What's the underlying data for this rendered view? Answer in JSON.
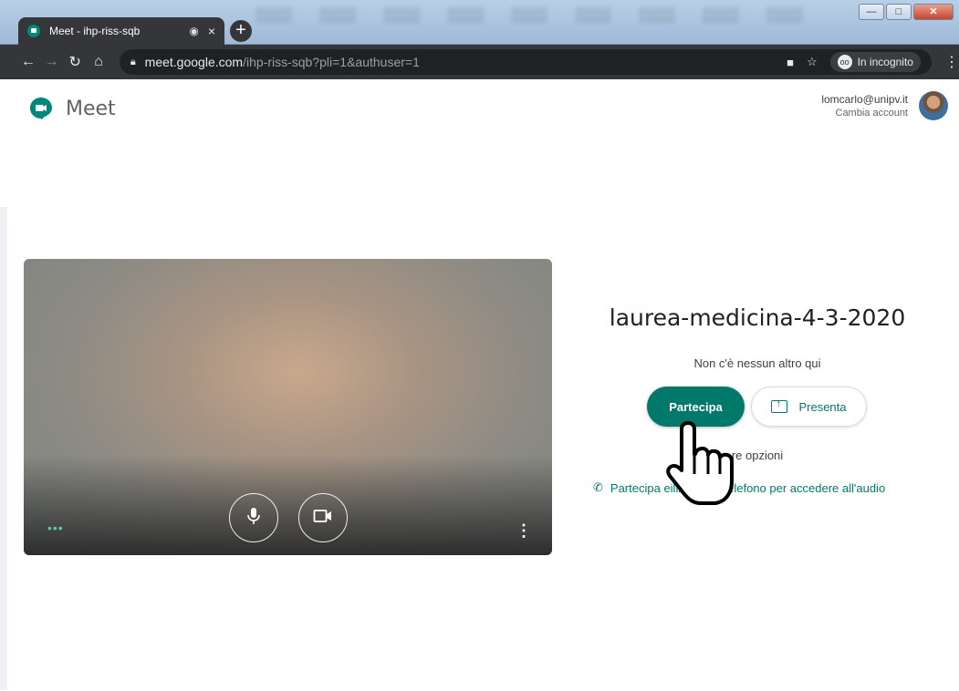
{
  "browser": {
    "tab_title": "Meet - ihp-riss-sqb",
    "tab_audio_icon": "record-dot-icon",
    "tab_close": "×",
    "new_tab": "+",
    "url_host": "meet.google.com",
    "url_path": "/ihp-riss-sqb?pli=1&authuser=1",
    "incognito_label": "In incognito",
    "window_controls": [
      "minimize",
      "maximize",
      "close"
    ]
  },
  "header": {
    "app_name": "Meet",
    "account_email": "lomcarlo@unipv.it",
    "switch_account": "Cambia account"
  },
  "preview": {
    "mic_icon": "microphone-icon",
    "camera_icon": "camera-icon",
    "dots": "•••"
  },
  "join": {
    "meeting_code": "laurea-medicina-4-3-2020",
    "status": "Non c'è nessun altro qui",
    "join_button": "Partecipa",
    "present_button": "Presenta",
    "more_options_visible": "re opzioni",
    "phone_part1": "Partecipa e",
    "phone_part2": "ilizza",
    "phone_part3": "n telefono per accedere all'audio"
  },
  "colors": {
    "accent": "#00796b",
    "chrome_dark": "#35363a"
  }
}
